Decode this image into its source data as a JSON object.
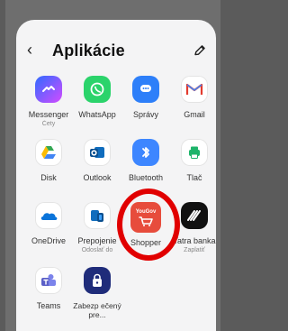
{
  "header": {
    "title": "Aplikácie"
  },
  "apps": [
    {
      "label": "Messenger",
      "sub": "Čety"
    },
    {
      "label": "WhatsApp",
      "sub": ""
    },
    {
      "label": "Správy",
      "sub": ""
    },
    {
      "label": "Gmail",
      "sub": ""
    },
    {
      "label": "Disk",
      "sub": ""
    },
    {
      "label": "Outlook",
      "sub": ""
    },
    {
      "label": "Bluetooth",
      "sub": ""
    },
    {
      "label": "Tlač",
      "sub": ""
    },
    {
      "label": "OneDrive",
      "sub": ""
    },
    {
      "label": "Prepojenie",
      "sub": "Odoslať do"
    },
    {
      "label": "Shopper",
      "sub": "",
      "icon_text": "YouGov"
    },
    {
      "label": "Tatra banka",
      "sub": "Zaplatiť"
    },
    {
      "label": "Teams",
      "sub": ""
    },
    {
      "label": "Zabezp\nečený pre...",
      "sub": ""
    }
  ]
}
